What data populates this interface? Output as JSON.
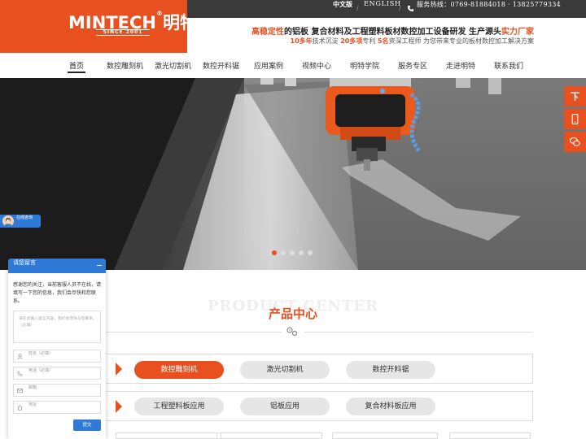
{
  "brand": {
    "name": "MINTECH",
    "cn_name": "明特",
    "since": "SINCE 2001"
  },
  "topbar": {
    "lang_cn": "中文版",
    "sep": "/",
    "lang_en": "ENGLISH",
    "hotline_label": "服务热线：",
    "hotline_numbers": "0769-81884018 · 13825779334"
  },
  "slogan": {
    "line1_a": "高稳定性",
    "line1_b": "的铝板 复合材料及工程塑料板材数控加工设备研发 生产源头",
    "line1_c": "实力厂家",
    "line2_a": "10多年",
    "line2_b": "技术沉淀",
    "line2_c": "20多项",
    "line2_d": "专利",
    "line2_e": "5名",
    "line2_f": "资深工程师 为您带来专业的板材数控加工解决方案"
  },
  "nav": [
    "首页",
    "数控雕刻机",
    "激光切割机",
    "数控开料锯",
    "应用案例",
    "视频中心",
    "明特学院",
    "服务专区",
    "走进明特",
    "联系我们"
  ],
  "banner": {
    "dots": 5,
    "active_dot": 0
  },
  "side_buttons": [
    "top-icon",
    "phone-icon",
    "wechat-icon"
  ],
  "section": {
    "title_en": "PRODUCT CENTER",
    "title_cn": "产品中心"
  },
  "category_rows": [
    [
      "数控雕刻机",
      "激光切割机",
      "数控开料锯"
    ],
    [
      "工程塑料板应用",
      "铝板应用",
      "复合材料板应用"
    ]
  ],
  "consult": {
    "label": "在线咨询"
  },
  "message": {
    "title": "请您留言",
    "intro": "感谢您的关注，当前客服人员不在线，请填写一下您的信息，我们会尽快和您联系。",
    "textarea_placeholder": "请在此输入留言内容，我们会尽快与您联系。（必填）",
    "fields": [
      "姓名（必填）",
      "电话（必填）",
      "邮箱",
      "地址"
    ],
    "submit": "提交"
  },
  "colors": {
    "accent": "#e8501f",
    "blue": "#2f7ad6",
    "dark_bar": "#3a3a3a"
  }
}
